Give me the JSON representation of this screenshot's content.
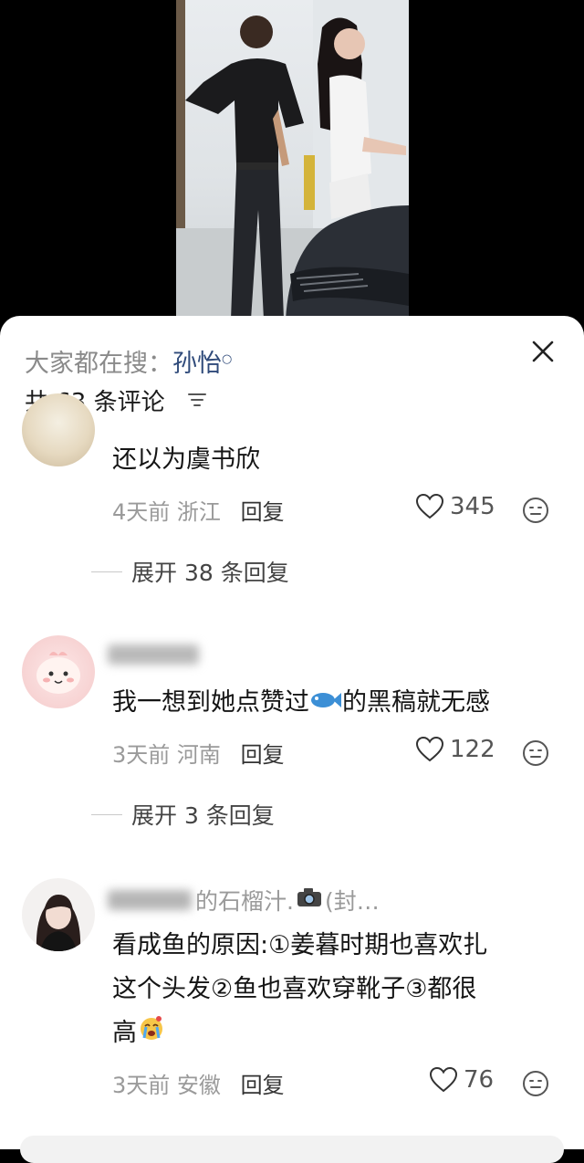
{
  "sheet": {
    "search_prefix": "大家都在搜：",
    "search_keyword": "孙怡",
    "comment_count": "共 63 条评论"
  },
  "comments": [
    {
      "text": "还以为虞书欣",
      "time": "4天前",
      "location": "浙江",
      "reply": "回复",
      "likes": "345",
      "expand": "展开 38 条回复"
    },
    {
      "text_before": "我一想到她点赞过",
      "text_after": "的黑稿就无感",
      "time": "3天前",
      "location": "河南",
      "reply": "回复",
      "likes": "122",
      "expand": "展开 3 条回复"
    },
    {
      "name_tail": "的石榴汁.",
      "name_suffix": "(封…",
      "line1": "看成鱼的原因:①姜暮时期也喜欢扎",
      "line2": "这个头发②鱼也喜欢穿靴子③都很",
      "line3": "高",
      "time": "3天前",
      "location": "安徽",
      "reply": "回复",
      "likes": "76"
    }
  ],
  "icons": {
    "close": "close-icon",
    "sort": "sort-icon",
    "like": "heart-icon",
    "react": "emoji-face-icon",
    "fish": "fish-emoji",
    "camera": "camera-emoji",
    "crying": "crying-emoji"
  },
  "colors": {
    "keyword": "#2f4a7a",
    "meta_gray": "#9a9a9a",
    "sheet_bg": "#ffffff"
  }
}
